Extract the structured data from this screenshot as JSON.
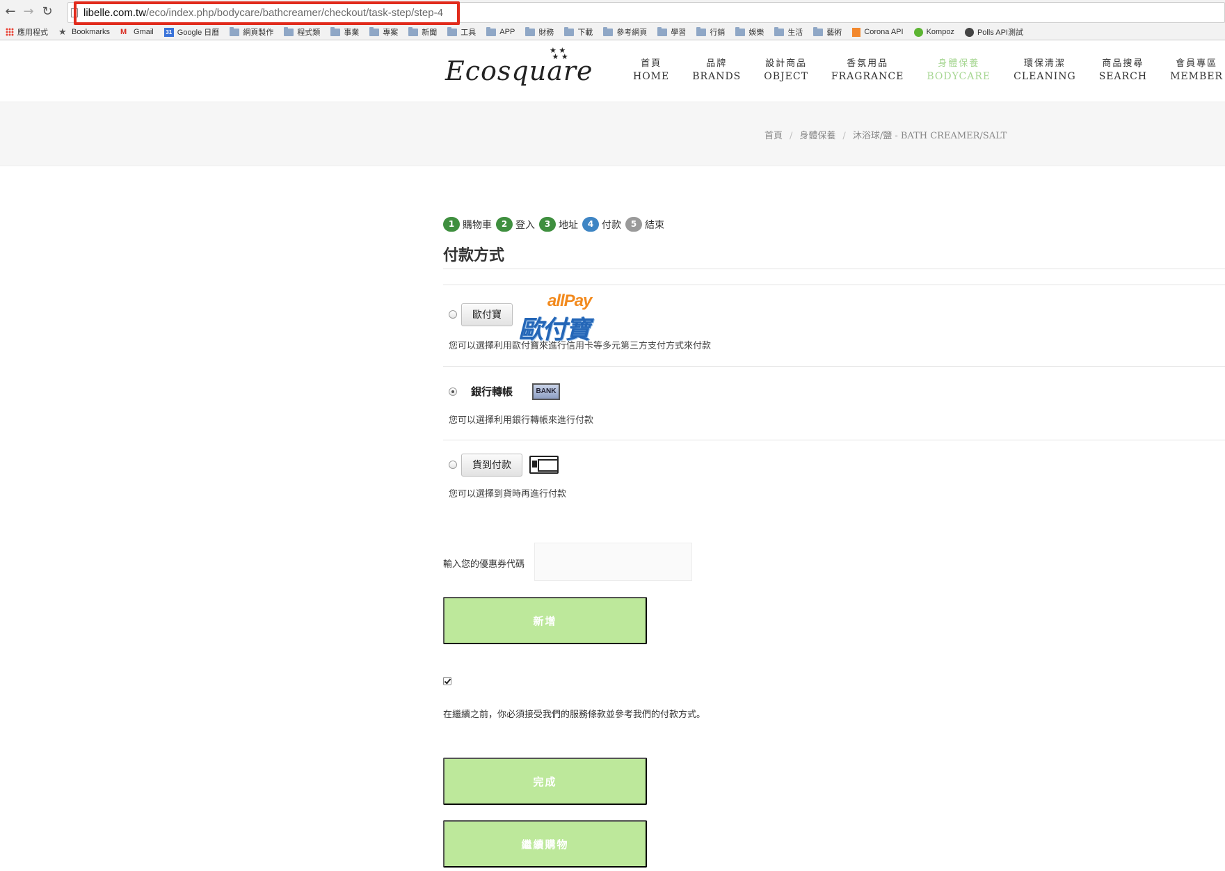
{
  "browser": {
    "url_domain": "libelle.com.tw",
    "url_path": "/eco/index.php/bodycare/bathcreamer/checkout/task-step/step-4",
    "back_glyph": "←",
    "forward_glyph": "→",
    "reload_glyph": "↻",
    "bookmarks": [
      {
        "label": "應用程式",
        "icon": "apps-icon"
      },
      {
        "label": "Bookmarks",
        "icon": "star-icon"
      },
      {
        "label": "Gmail",
        "icon": "gmail-icon"
      },
      {
        "label": "Google 日曆",
        "icon": "calendar-icon"
      },
      {
        "label": "網頁製作",
        "icon": "folder-icon"
      },
      {
        "label": "程式類",
        "icon": "folder-icon"
      },
      {
        "label": "事業",
        "icon": "folder-icon"
      },
      {
        "label": "專案",
        "icon": "folder-icon"
      },
      {
        "label": "新聞",
        "icon": "folder-icon"
      },
      {
        "label": "工具",
        "icon": "folder-icon"
      },
      {
        "label": "APP",
        "icon": "folder-icon"
      },
      {
        "label": "財務",
        "icon": "folder-icon"
      },
      {
        "label": "下載",
        "icon": "folder-icon"
      },
      {
        "label": "參考網頁",
        "icon": "folder-icon"
      },
      {
        "label": "學習",
        "icon": "folder-icon"
      },
      {
        "label": "行銷",
        "icon": "folder-icon"
      },
      {
        "label": "娛樂",
        "icon": "folder-icon"
      },
      {
        "label": "生活",
        "icon": "folder-icon"
      },
      {
        "label": "藝術",
        "icon": "folder-icon"
      },
      {
        "label": "Corona API",
        "icon": "bookmark-orange-icon"
      },
      {
        "label": "Kompoz",
        "icon": "bookmark-green-icon"
      },
      {
        "label": "Polls API測試",
        "icon": "github-icon"
      }
    ],
    "highlight_color": "#e12b1c"
  },
  "header": {
    "logo_text": "Ecosquare",
    "logo_stars": "★ ★\n★ ★",
    "menu": [
      {
        "zh": "首頁",
        "en": "HOME",
        "active": false
      },
      {
        "zh": "品牌",
        "en": "BRANDS",
        "active": false
      },
      {
        "zh": "設計商品",
        "en": "OBJECT",
        "active": false
      },
      {
        "zh": "香氛用品",
        "en": "FRAGRANCE",
        "active": false
      },
      {
        "zh": "身體保養",
        "en": "BODYCARE",
        "active": true
      },
      {
        "zh": "環保清潔",
        "en": "CLEANING",
        "active": false
      },
      {
        "zh": "商品搜尋",
        "en": "SEARCH",
        "active": false
      },
      {
        "zh": "會員專區",
        "en": "MEMBER",
        "active": false
      }
    ],
    "active_color": "#a8d794"
  },
  "breadcrumb": {
    "items": [
      "首頁",
      "身體保養",
      "沐浴球/鹽 - BATH CREAMER/SALT"
    ],
    "separator": "/"
  },
  "checkout": {
    "steps": [
      {
        "num": "1",
        "label": "購物車",
        "state": "done"
      },
      {
        "num": "2",
        "label": "登入",
        "state": "done"
      },
      {
        "num": "3",
        "label": "地址",
        "state": "done"
      },
      {
        "num": "4",
        "label": "付款",
        "state": "current"
      },
      {
        "num": "5",
        "label": "結束",
        "state": "todo"
      }
    ],
    "title": "付款方式",
    "payment_methods": [
      {
        "label": "歐付寶",
        "logo_en": "allPay",
        "logo_zh": "歐付寶",
        "description": "您可以選擇利用歐付寶來進行信用卡等多元第三方支付方式來付款",
        "selected": false
      },
      {
        "label": "銀行轉帳",
        "logo_text": "BANK",
        "description": "您可以選擇利用銀行轉帳來進行付款",
        "selected": true
      },
      {
        "label": "貨到付款",
        "description": "您可以選擇到貨時再進行付款",
        "selected": false
      }
    ],
    "coupon_label": "輸入您的優惠券代碼",
    "coupon_value": "",
    "add_button": "新增",
    "agree_checked": true,
    "terms_text": "在繼續之前，你必須接受我們的服務條款並參考我們的付款方式。",
    "finish_button": "完成",
    "continue_button": "繼續購物",
    "button_color": "#bde89b"
  }
}
